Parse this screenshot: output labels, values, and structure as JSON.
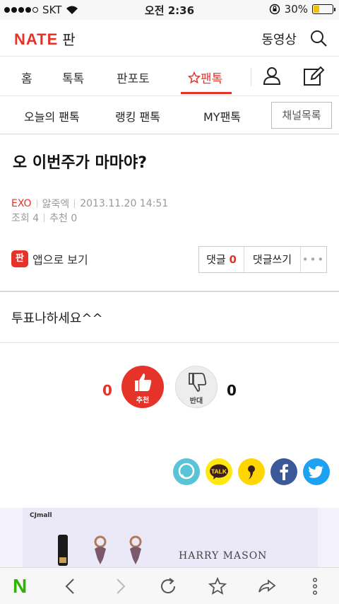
{
  "status_bar": {
    "carrier": "SKT",
    "time": "오전 2:36",
    "battery": "30%",
    "battery_level": 0.3
  },
  "header": {
    "logo": "NATE",
    "section": "판",
    "video": "동영상"
  },
  "nav": {
    "items": [
      "홈",
      "톡톡",
      "판포토",
      "팬톡"
    ],
    "active": "팬톡"
  },
  "subnav": {
    "items": [
      "오늘의 팬톡",
      "랭킹 팬톡",
      "MY팬톡"
    ],
    "channel_button": "채널목록"
  },
  "article": {
    "title": "오 이번주가 마마야?",
    "category": "EXO",
    "author": "앓죽엑",
    "datetime": "2013.11.20 14:51",
    "views": "조회 4",
    "recommend": "추천 0",
    "body": "투표나하세요^^"
  },
  "actions": {
    "app_icon": "판",
    "app_view": "앱으로 보기",
    "comments_label": "댓글",
    "comments_count": "0",
    "write_comment": "댓글쓰기",
    "more": "•••"
  },
  "vote": {
    "up_count": "0",
    "up_label": "추천",
    "down_label": "반대",
    "down_count": "0"
  },
  "share": [
    "speech-bubble",
    "kakaotalk",
    "kakaostory",
    "facebook",
    "twitter"
  ],
  "share_talk": "TALK",
  "ad": {
    "brand": "CJmall",
    "text": "HARRY MASON"
  },
  "bottom_bar": {
    "logo": "N"
  },
  "colors": {
    "accent": "#e6332a",
    "naver_green": "#2db400",
    "facebook": "#3b5998",
    "twitter": "#1da1f2",
    "kakao": "#ffe812"
  }
}
